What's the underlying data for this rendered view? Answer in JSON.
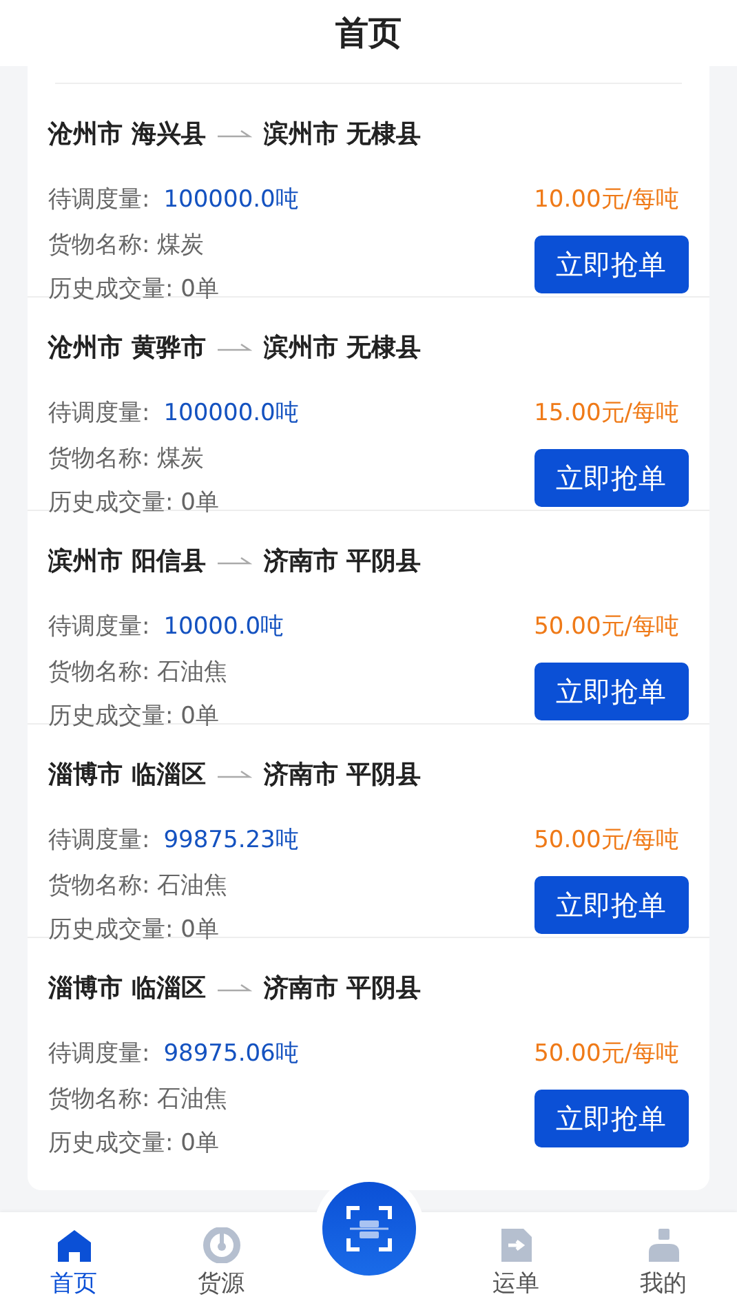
{
  "header": {
    "title": "首页"
  },
  "orders": [
    {
      "origin": "沧州市 海兴县",
      "destination": "滨州市 无棣县",
      "quantity_label": "待调度量:",
      "quantity": "100000.0吨",
      "price": "10.00元/每吨",
      "goods": "货物名称: 煤炭",
      "history": "历史成交量: 0单",
      "button": "立即抢单"
    },
    {
      "origin": "沧州市 黄骅市",
      "destination": "滨州市 无棣县",
      "quantity_label": "待调度量:",
      "quantity": "100000.0吨",
      "price": "15.00元/每吨",
      "goods": "货物名称: 煤炭",
      "history": "历史成交量: 0单",
      "button": "立即抢单"
    },
    {
      "origin": "滨州市 阳信县",
      "destination": "济南市 平阴县",
      "quantity_label": "待调度量:",
      "quantity": "10000.0吨",
      "price": "50.00元/每吨",
      "goods": "货物名称: 石油焦",
      "history": "历史成交量: 0单",
      "button": "立即抢单"
    },
    {
      "origin": "淄博市 临淄区",
      "destination": "济南市 平阴县",
      "quantity_label": "待调度量:",
      "quantity": "99875.23吨",
      "price": "50.00元/每吨",
      "goods": "货物名称: 石油焦",
      "history": "历史成交量: 0单",
      "button": "立即抢单"
    },
    {
      "origin": "淄博市 临淄区",
      "destination": "济南市 平阴县",
      "quantity_label": "待调度量:",
      "quantity": "98975.06吨",
      "price": "50.00元/每吨",
      "goods": "货物名称: 石油焦",
      "history": "历史成交量: 0单",
      "button": "立即抢单"
    }
  ],
  "tab_bar": [
    {
      "kind": "home",
      "label": "首页",
      "selected": true
    },
    {
      "kind": "source",
      "label": "货源",
      "selected": false
    },
    {
      "kind": "scan"
    },
    {
      "kind": "waybill",
      "label": "运单",
      "selected": false
    },
    {
      "kind": "profile",
      "label": "我的",
      "selected": false
    }
  ]
}
